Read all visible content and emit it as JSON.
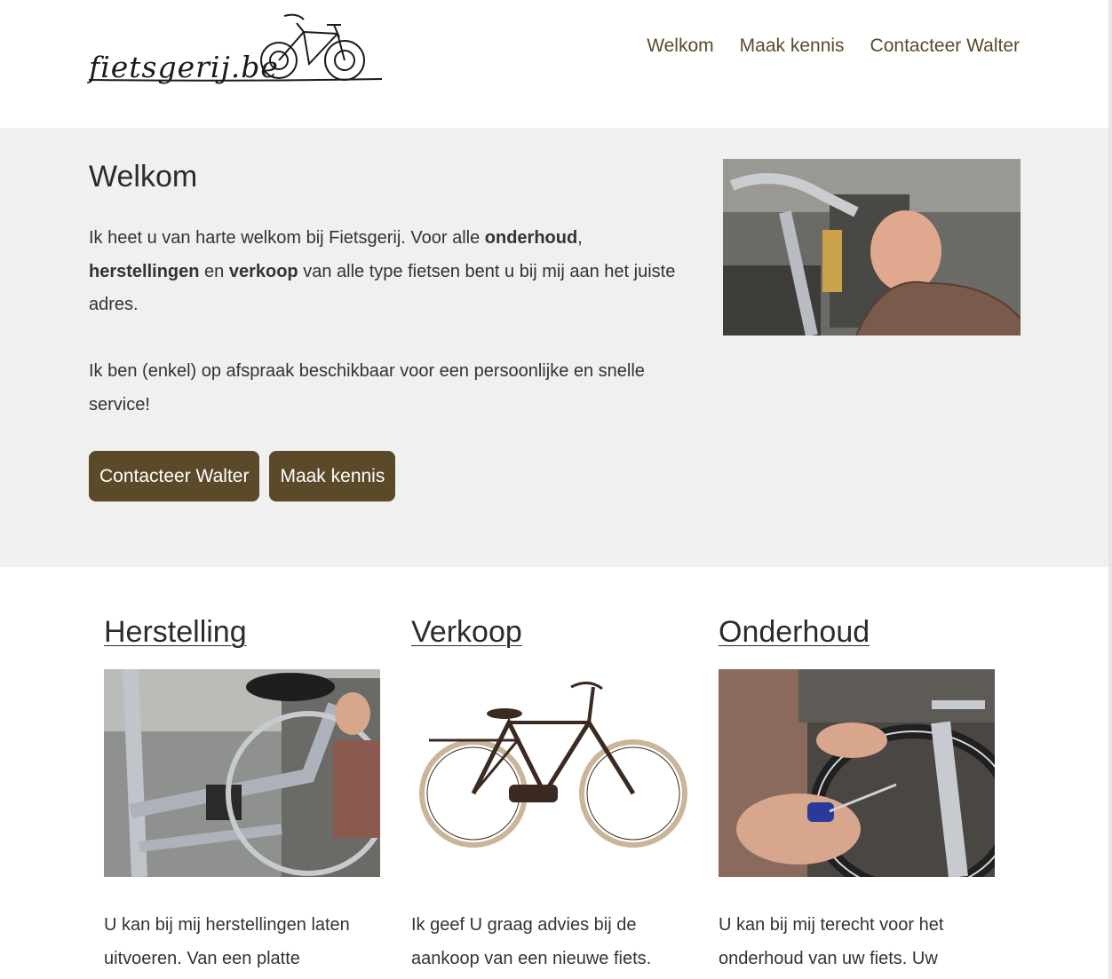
{
  "brand": {
    "logo_text": "fietsgerij.be"
  },
  "nav": {
    "items": [
      {
        "label": "Welkom"
      },
      {
        "label": "Maak kennis"
      },
      {
        "label": "Contacteer Walter"
      }
    ]
  },
  "hero": {
    "title": "Welkom",
    "para1_before": "Ik heet u van harte welkom bij Fietsgerij. Voor alle ",
    "para1_b1": "onderhoud",
    "para1_sep1": ", ",
    "para1_b2": "herstellingen",
    "para1_sep2": " en ",
    "para1_b3": "verkoop",
    "para1_after": " van alle type fietsen bent u bij mij aan het juiste adres.",
    "para2": "Ik ben (enkel) op afspraak beschikbaar voor een persoonlijke en snelle service!",
    "buttons": {
      "contact": "Contacteer Walter",
      "meet": "Maak kennis"
    }
  },
  "services": [
    {
      "title": "Herstelling",
      "text": "U kan bij mij herstellingen laten uitvoeren.  Van een platte"
    },
    {
      "title": "Verkoop",
      "text": "Ik geef U graag advies bij de aankoop van een nieuwe fiets."
    },
    {
      "title": "Onderhoud",
      "text": "U kan bij mij terecht voor het onderhoud van uw fiets.  Uw"
    }
  ],
  "colors": {
    "accent": "#5a4a2a",
    "hero_bg": "#f0f0f0",
    "text": "#2b2b2b"
  }
}
